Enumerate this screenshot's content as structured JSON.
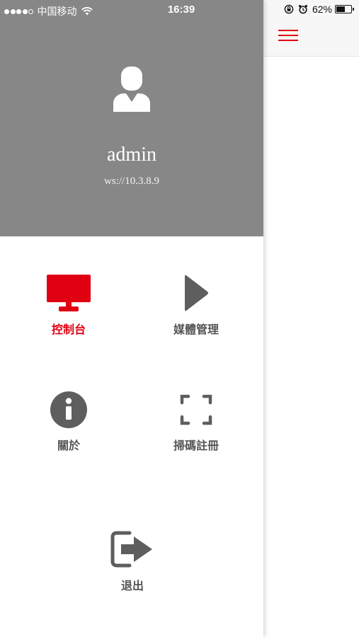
{
  "status_bar": {
    "carrier": "中国移动",
    "time": "16:39",
    "battery_percent": "62%",
    "battery_level": 0.62
  },
  "profile": {
    "username": "admin",
    "server": "ws://10.3.8.9"
  },
  "menu": {
    "items": [
      {
        "label": "控制台",
        "icon": "monitor-icon",
        "active": true
      },
      {
        "label": "媒體管理",
        "icon": "play-icon",
        "active": false
      },
      {
        "label": "關於",
        "icon": "info-icon",
        "active": false
      },
      {
        "label": "掃碼註冊",
        "icon": "scan-icon",
        "active": false
      },
      {
        "label": "退出",
        "icon": "logout-icon",
        "active": false
      }
    ]
  },
  "colors": {
    "accent": "#e00012",
    "profile_bg": "#878787",
    "icon_gray": "#5e5e5e"
  }
}
